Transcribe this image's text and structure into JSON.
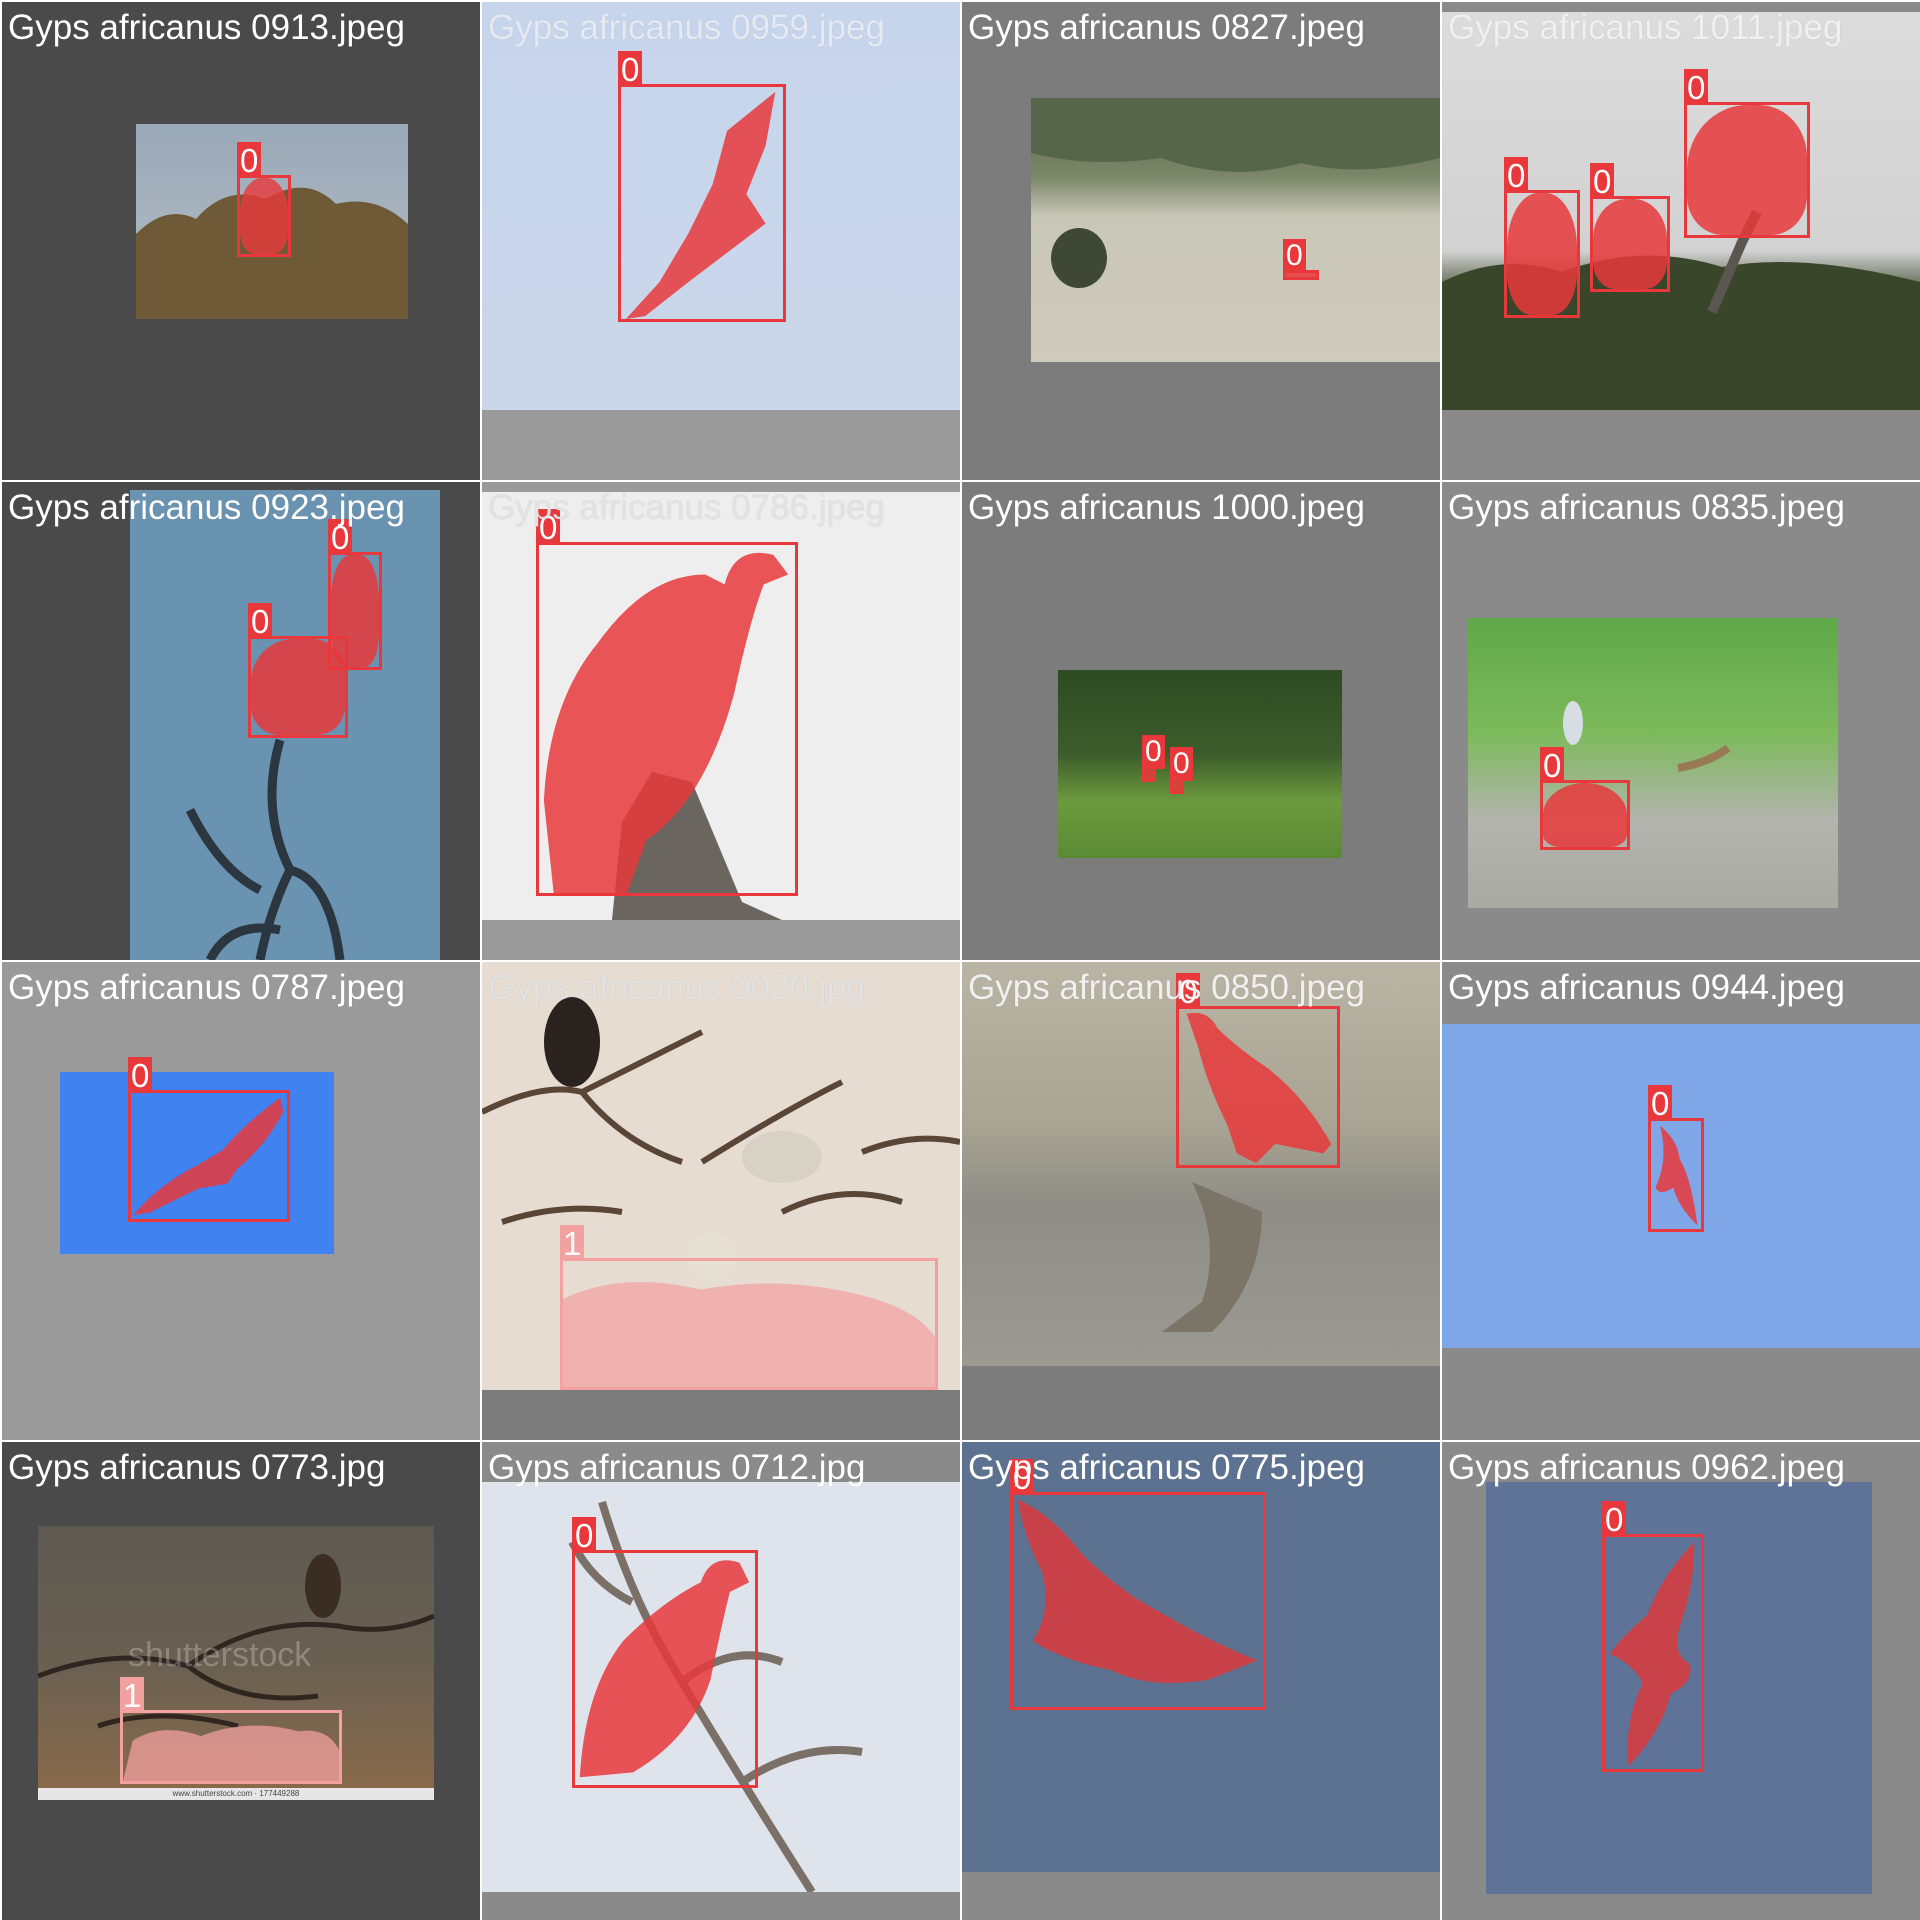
{
  "tiles": [
    {
      "title": "Gyps africanus 0913.jpeg",
      "labels": [
        "0"
      ]
    },
    {
      "title": "Gyps africanus 0959.jpeg",
      "labels": [
        "0"
      ]
    },
    {
      "title": "Gyps africanus 0827.jpeg",
      "labels": [
        "0"
      ]
    },
    {
      "title": "Gyps africanus 1011.jpeg",
      "labels": [
        "0",
        "0",
        "0"
      ]
    },
    {
      "title": "Gyps africanus 0923.jpeg",
      "labels": [
        "0",
        "0"
      ]
    },
    {
      "title": "Gyps africanus 0786.jpeg",
      "labels": [
        "0"
      ]
    },
    {
      "title": "Gyps africanus 1000.jpeg",
      "labels": [
        "0",
        "0"
      ]
    },
    {
      "title": "Gyps africanus 0835.jpeg",
      "labels": [
        "0"
      ]
    },
    {
      "title": "Gyps africanus 0787.jpeg",
      "labels": [
        "0"
      ]
    },
    {
      "title": "Gyps africanus 0020.jpg",
      "labels": [
        "1"
      ]
    },
    {
      "title": "Gyps africanus 0850.jpeg",
      "labels": [
        "0"
      ]
    },
    {
      "title": "Gyps africanus 0944.jpeg",
      "labels": [
        "0"
      ]
    },
    {
      "title": "Gyps africanus 0773.jpg",
      "labels": [
        "1"
      ],
      "watermark": "shutterstock",
      "footer": "www.shutterstock.com · 177449288"
    },
    {
      "title": "Gyps africanus 0712.jpg",
      "labels": [
        "0"
      ]
    },
    {
      "title": "Gyps africanus 0775.jpeg",
      "labels": [
        "0"
      ]
    },
    {
      "title": "Gyps africanus 0962.jpeg",
      "labels": [
        "0"
      ]
    }
  ],
  "colors": {
    "box_class_0": "#e8383b",
    "box_class_1": "#f2a0a0",
    "mask_class_0": "rgba(232,56,59,0.8)",
    "mask_class_1": "rgba(242,160,160,0.7)"
  }
}
